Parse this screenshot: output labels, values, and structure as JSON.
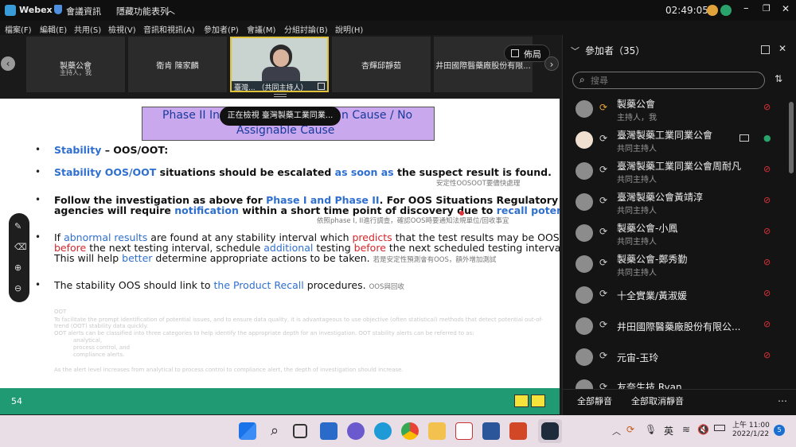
{
  "titlebar": {
    "app_name": "Webex",
    "meeting_info": "會議資訊",
    "hide_menu": "隱藏功能表列",
    "time": "02:49:05"
  },
  "menu": [
    "檔案(F)",
    "編輯(E)",
    "共用(S)",
    "檢視(V)",
    "音訊和視訊(A)",
    "參加者(P)",
    "會議(M)",
    "分組討論(B)",
    "說明(H)"
  ],
  "video_tiles": [
    {
      "name": "製藥公會",
      "role": "主持人，我"
    },
    {
      "name": "衛肯 陳家麟",
      "role": ""
    },
    {
      "name": "臺灣... （共同主持人）",
      "role": ""
    },
    {
      "name": "杏輝邱靜茹",
      "role": ""
    },
    {
      "name": "井田國際醫藥廠股份有限...",
      "role": ""
    }
  ],
  "layout_button": "佈局",
  "viewing_banner": "正在檢視 臺灣製藥工業同業...",
  "slide": {
    "title_line1_left": "Phase II In",
    "title_line1_right": "n Cause / No",
    "title_line2": "Assignable  Cause",
    "b1": {
      "t1": "Stability",
      "t2": " – OOS/OOT:"
    },
    "b2": {
      "t1": "Stability OOS/OOT",
      "t2": " situations should be escalated ",
      "t3": "as soon as",
      "t4": " the suspect result is found.",
      "cn": "安定性OOSOOT要儘快處理"
    },
    "b3": {
      "l1a": " Follow the investigation as above for ",
      "l1b": "Phase I and Phase II",
      "l1c": ".  For OOS Situations Regulatory",
      "l2a": "agencies will require ",
      "l2b": "notification",
      "l2c": " within a short time point of discovery due to ",
      "l2d": "recall potential",
      "l2e": ".",
      "cn": "依照phase I, II進行調查，確認OOS時要通知法規單位/回收事宜"
    },
    "b4": {
      "l1a": "If ",
      "l1b": "abnormal results",
      "l1c": " are found at any stability interval which ",
      "l1d": "predicts",
      "l1e": " that the test results may be OOS",
      "l2a": "before",
      "l2b": " the next testing interval, schedule ",
      "l2c": "additional",
      "l2d": " testing ",
      "l2e": "before",
      "l2f": " the next scheduled testing interval.",
      "l3a": "This will help ",
      "l3b": "better",
      "l3c": " determine appropriate actions to be taken.",
      "cn": "若是安定性預測會有OOS，額外增加測試"
    },
    "b5": {
      "t1": "The stability OOS should link to ",
      "t2": "the Product Recall",
      "t3": " procedures.",
      "cn": "OOS與回收"
    },
    "faint": [
      "OOT",
      "To facilitate the prompt identification of potential issues, and to ensure data quality, it is advantageous to use objective (often statistical) methods that detect potential out-of-",
      "trend (OOT) stability data quickly.",
      "OOT alerts can be classified into three categories to help identify the appropriate depth for an investigation. OOT stability alerts can be referred to as:",
      "analytical,",
      "process control, and",
      "compliance alerts.",
      "As the alert level increases from analytical to process control to compliance alert, the depth of investigation should increase."
    ],
    "page_number": "54"
  },
  "panel": {
    "header": "參加者（35）",
    "search_placeholder": "搜尋",
    "participants": [
      {
        "name": "製藥公會",
        "role": "主持人，我"
      },
      {
        "name": "臺灣製藥工業同業公會",
        "role": "共同主持人"
      },
      {
        "name": "臺灣製藥工業同業公會周耐凡",
        "role": "共同主持人"
      },
      {
        "name": "臺灣製藥公會黃靖淳",
        "role": "共同主持人"
      },
      {
        "name": "製藥公會-小鳳",
        "role": "共同主持人"
      },
      {
        "name": "製藥公會-鄭秀勤",
        "role": "共同主持人"
      },
      {
        "name": "十全實業/黃淑媛",
        "role": ""
      },
      {
        "name": "井田國際醫藥廠股份有限公...",
        "role": ""
      },
      {
        "name": "元宙-玉玲",
        "role": ""
      },
      {
        "name": "友奈生技 Ryan",
        "role": ""
      }
    ],
    "mute_all": "全部靜音",
    "unmute_all": "全部取消靜音"
  },
  "taskbar": {
    "ime": "英",
    "ampm": "上午 11:00",
    "date": "2022/1/22",
    "notifications": "5"
  }
}
